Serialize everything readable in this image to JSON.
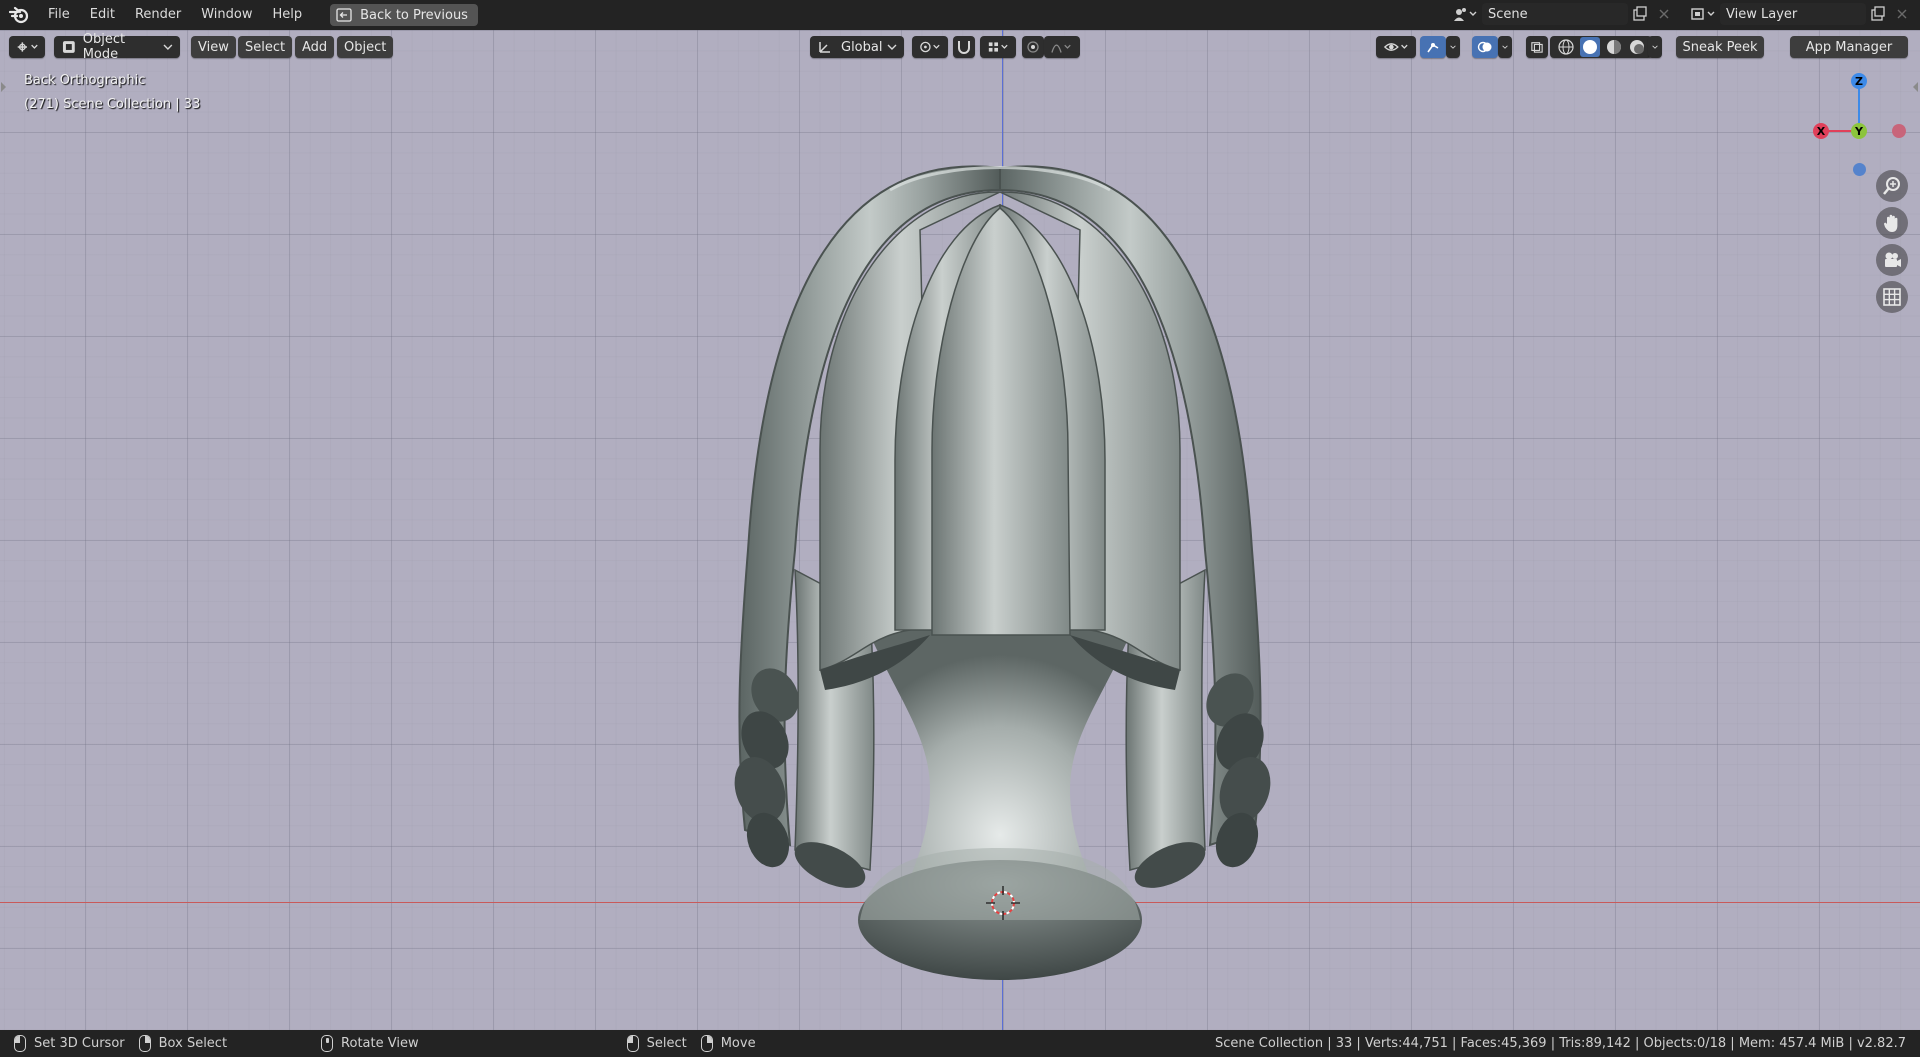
{
  "menu": {
    "items": [
      "File",
      "Edit",
      "Render",
      "Window",
      "Help"
    ],
    "back_button": "Back to Previous"
  },
  "scene": {
    "name": "Scene"
  },
  "view_layer": {
    "name": "View Layer"
  },
  "viewport_header": {
    "mode": "Object Mode",
    "menus": [
      "View",
      "Select",
      "Add",
      "Object"
    ],
    "orientation": "Global",
    "sneak_peek": "Sneak Peek",
    "app_manager": "App Manager"
  },
  "viewport": {
    "view_name": "Back Orthographic",
    "collection_info": "(271) Scene Collection | 33"
  },
  "gizmo": {
    "x": "X",
    "y": "Y",
    "z": "Z"
  },
  "statusbar": {
    "set_cursor": "Set 3D Cursor",
    "box_select": "Box Select",
    "rotate_view": "Rotate View",
    "select": "Select",
    "move": "Move",
    "stats": "Scene Collection | 33 | Verts:44,751 | Faces:45,369 | Tris:89,142 | Objects:0/18 | Mem: 457.4 MiB | v2.82.7"
  },
  "colors": {
    "viewport_bg": "#b1aec0",
    "x_axis": "#e0405a",
    "y_axis": "#8cc43c",
    "z_axis": "#3d8ae8"
  }
}
